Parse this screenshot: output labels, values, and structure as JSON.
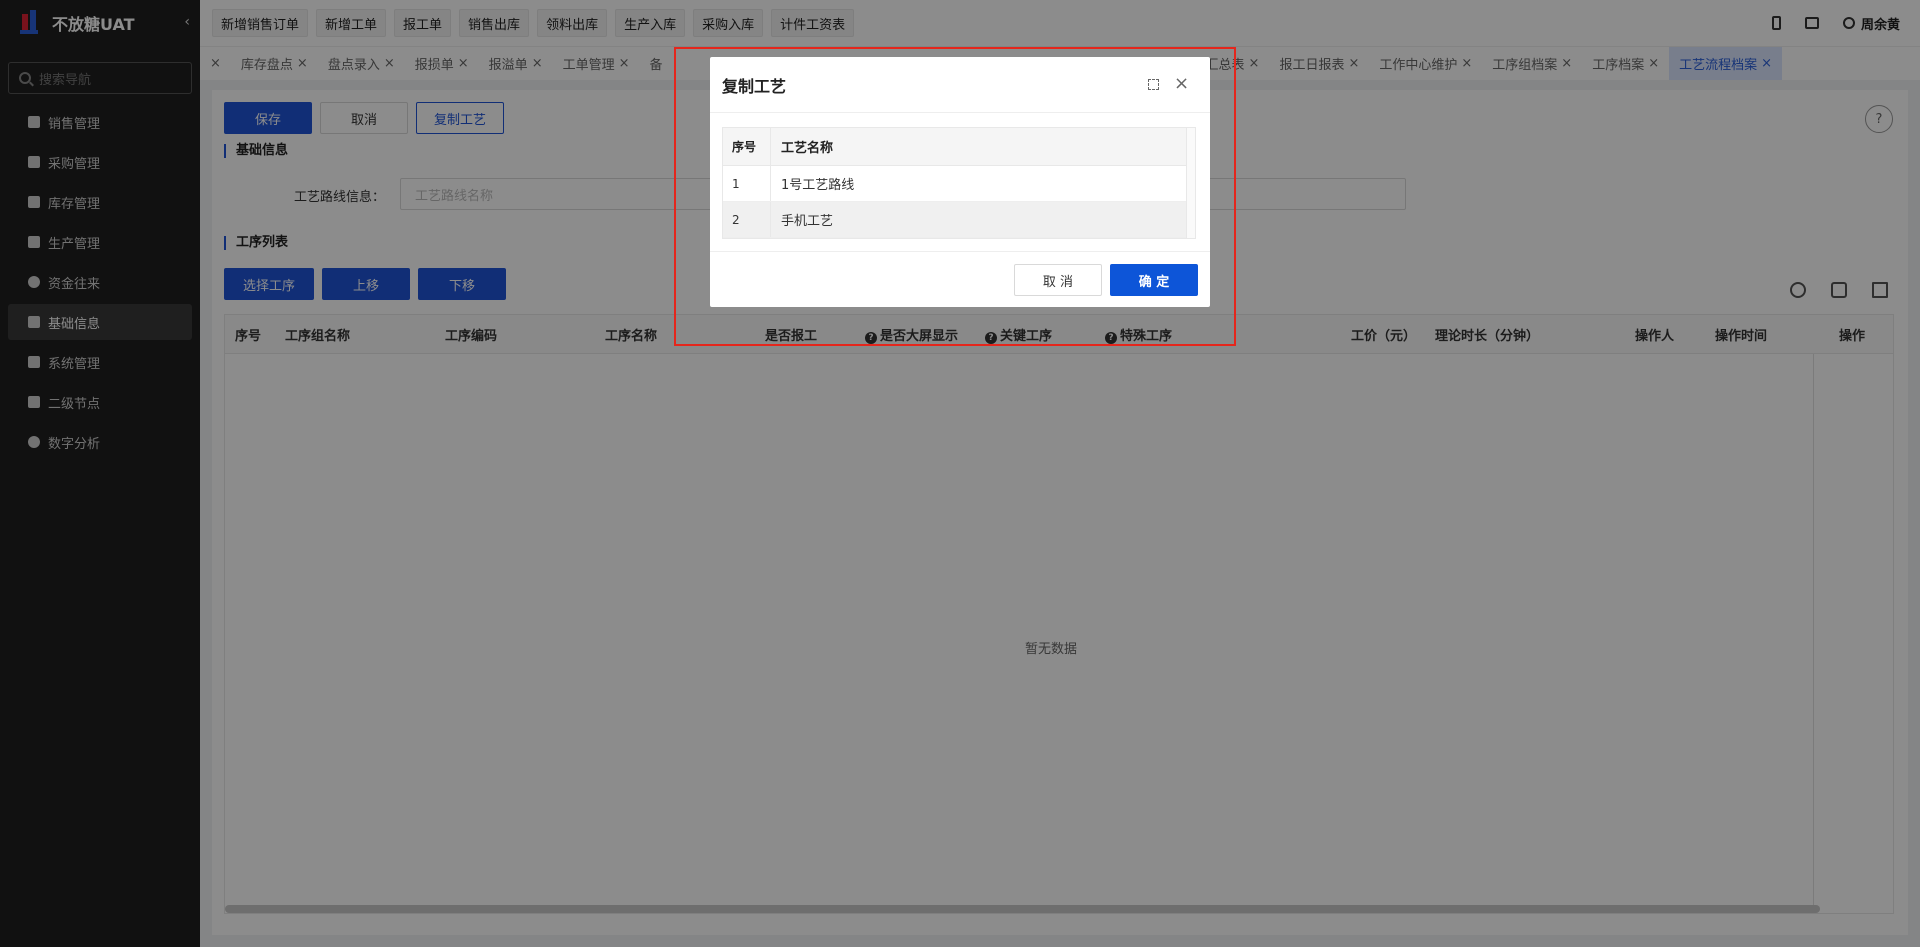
{
  "sidebar": {
    "brand": "不放糖UAT",
    "collapse_glyph": "‹",
    "search_placeholder": "搜索导航",
    "items": [
      {
        "label": "销售管理",
        "icon": "tag-icon"
      },
      {
        "label": "采购管理",
        "icon": "cart-icon"
      },
      {
        "label": "库存管理",
        "icon": "box-icon"
      },
      {
        "label": "生产管理",
        "icon": "factory-icon"
      },
      {
        "label": "资金往来",
        "icon": "money-icon"
      },
      {
        "label": "基础信息",
        "icon": "dashboard-icon",
        "active": true
      },
      {
        "label": "系统管理",
        "icon": "apps-icon"
      },
      {
        "label": "二级节点",
        "icon": "doc-icon"
      },
      {
        "label": "数字分析",
        "icon": "pie-icon"
      }
    ]
  },
  "topbar": {
    "quick_buttons": [
      "新增销售订单",
      "新增工单",
      "报工单",
      "销售出库",
      "领料出库",
      "生产入库",
      "采购入库",
      "计件工资表"
    ],
    "user_name": "周余黄"
  },
  "tabs": [
    {
      "label": "",
      "closable": true
    },
    {
      "label": "库存盘点"
    },
    {
      "label": "盘点录入"
    },
    {
      "label": "报损单"
    },
    {
      "label": "报溢单"
    },
    {
      "label": "工单管理"
    },
    {
      "label": "备"
    },
    {
      "label": ""
    },
    {
      "label": ""
    },
    {
      "label": ""
    },
    {
      "label": "报工汇总表"
    },
    {
      "label": "报工日报表"
    },
    {
      "label": "工作中心维护"
    },
    {
      "label": "工序组档案"
    },
    {
      "label": "工序档案"
    },
    {
      "label": "工艺流程档案",
      "active": true
    }
  ],
  "toolbar": {
    "save": "保存",
    "cancel": "取消",
    "copy": "复制工艺"
  },
  "basic_info": {
    "title": "基础信息",
    "route_label": "工艺路线信息：",
    "route_placeholder": "工艺路线名称"
  },
  "process_list": {
    "title": "工序列表",
    "select": "选择工序",
    "move_up": "上移",
    "move_down": "下移",
    "columns": [
      "序号",
      "工序组名称",
      "工序编码",
      "工序名称",
      "是否报工",
      "是否大屏显示",
      "关键工序",
      "特殊工序",
      "工价（元）",
      "理论时长（分钟）",
      "操作人",
      "操作时间",
      "操作"
    ],
    "empty_text": "暂无数据"
  },
  "help_glyph": "?",
  "modal": {
    "title": "复制工艺",
    "close_glyph": "×",
    "columns": [
      "序号",
      "工艺名称"
    ],
    "rows": [
      {
        "no": "1",
        "name": "1号工艺路线"
      },
      {
        "no": "2",
        "name": "手机工艺"
      }
    ],
    "cancel": "取 消",
    "ok": "确 定"
  },
  "colors": {
    "primary": "#2055d8",
    "highlight": "#e5261c",
    "sidebar": "#1f1f1f"
  }
}
